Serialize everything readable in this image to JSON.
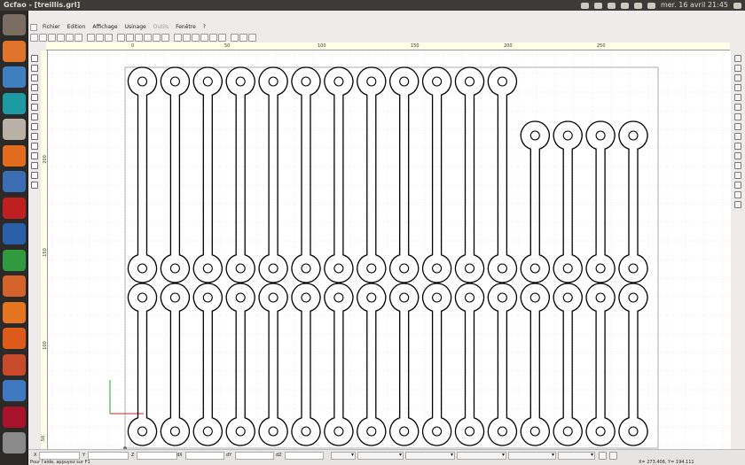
{
  "window": {
    "title": "Gcfao - [treillis.grl]",
    "clock": "mer. 16 avril 21:45"
  },
  "menu": [
    {
      "label": "Fichier",
      "enabled": true
    },
    {
      "label": "Edition",
      "enabled": true
    },
    {
      "label": "Affichage",
      "enabled": true
    },
    {
      "label": "Usinage",
      "enabled": true
    },
    {
      "label": "Outils",
      "enabled": false
    },
    {
      "label": "Fenêtre",
      "enabled": true
    },
    {
      "label": "?",
      "enabled": true
    }
  ],
  "ruler": {
    "h_ticks": [
      "0",
      "50",
      "100",
      "150",
      "200",
      "250"
    ],
    "v_ticks": [
      "200",
      "150",
      "100",
      "50"
    ]
  },
  "launcher": [
    {
      "name": "ubuntu-dash-icon",
      "color": "#7a6d62"
    },
    {
      "name": "files-icon",
      "color": "#e0742b"
    },
    {
      "name": "seahorse-icon",
      "color": "#3f7fc0"
    },
    {
      "name": "arduino-icon",
      "color": "#1b9aa1"
    },
    {
      "name": "archive-icon",
      "color": "#b9b0a6"
    },
    {
      "name": "firefox-icon",
      "color": "#e36b1c"
    },
    {
      "name": "thunderbird-icon",
      "color": "#3a6db3"
    },
    {
      "name": "filezilla-icon",
      "color": "#bf1f1f"
    },
    {
      "name": "writer-icon",
      "color": "#2a5fa8"
    },
    {
      "name": "calc-icon",
      "color": "#2f9a3e"
    },
    {
      "name": "impress-icon",
      "color": "#d5612b"
    },
    {
      "name": "software-center-icon",
      "color": "#e4741f"
    },
    {
      "name": "ubuntu-one-icon",
      "color": "#dd5a1a"
    },
    {
      "name": "system-settings-icon",
      "color": "#c84a2a"
    },
    {
      "name": "system-monitor-icon",
      "color": "#3d78c0"
    },
    {
      "name": "wine-icon",
      "color": "#a8132b"
    },
    {
      "name": "workspaces-icon",
      "color": "#8a8a8a"
    }
  ],
  "drawing": {
    "top_row": {
      "count": 12,
      "extra_short": 4
    },
    "bottom_row": {
      "count": 16
    }
  },
  "status": {
    "x_label": "X",
    "y_label": "Y",
    "z_label": "Z",
    "dx_label": "dX",
    "dy_label": "dY",
    "dz_label": "dZ",
    "help": "Pour l'aide, appuyez sur F1",
    "coords": "X= 273.406, Y= 194.111"
  }
}
